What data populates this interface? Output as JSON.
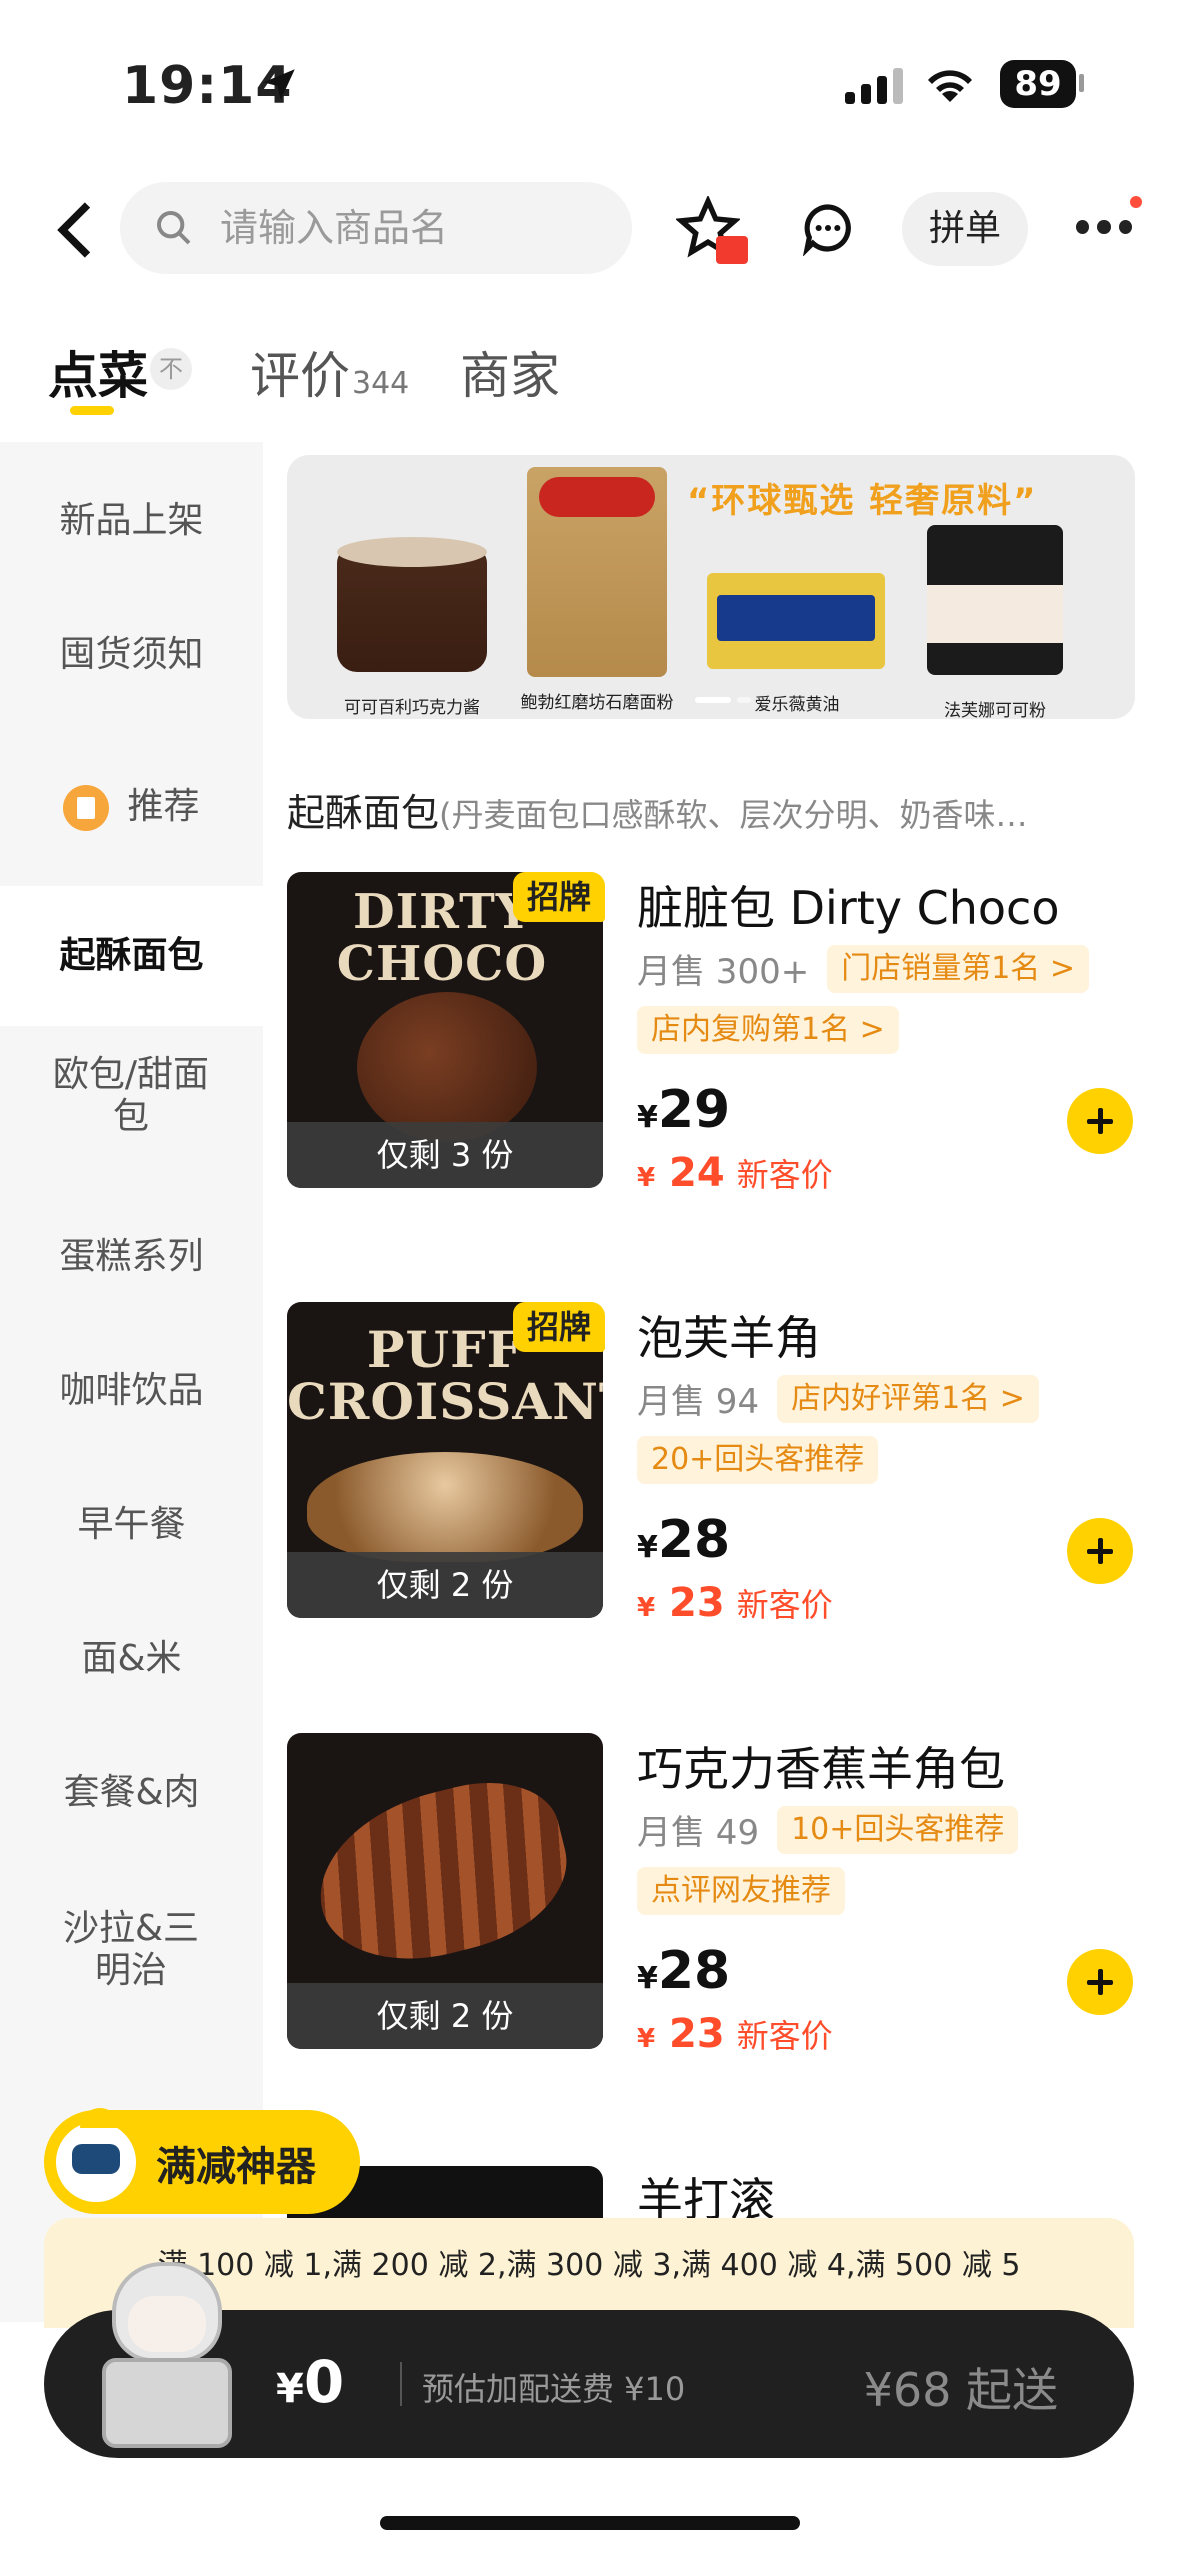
{
  "status_bar": {
    "time": "19:14",
    "battery": "89",
    "icons": [
      "location-arrow-icon",
      "signal-icon",
      "wifi-icon",
      "battery-icon"
    ]
  },
  "header": {
    "search_placeholder": "请输入商品名",
    "group_order_label": "拼单",
    "icons": [
      "back-icon",
      "search-icon",
      "favorite-star-icon",
      "chat-icon",
      "more-icon"
    ]
  },
  "tabs": [
    {
      "label": "点菜"
    },
    {
      "label": "评价",
      "count": "344"
    },
    {
      "label": "商家"
    }
  ],
  "tab_top_glyph": "不",
  "sidebar": {
    "items": [
      {
        "label": "新品上架"
      },
      {
        "label": "囤货须知"
      },
      {
        "label": "推荐"
      },
      {
        "label": "起酥面包"
      },
      {
        "label": "欧包/甜面包"
      },
      {
        "label": "蛋糕系列"
      },
      {
        "label": "咖啡饮品"
      },
      {
        "label": "早午餐"
      },
      {
        "label": "面&米"
      },
      {
        "label": "套餐&肉"
      },
      {
        "label": "沙拉&三明治"
      }
    ],
    "active_index": 3
  },
  "banner": {
    "slogan": "“环球甄选 轻奢原料”",
    "products": [
      {
        "caption": "可可百利巧克力酱"
      },
      {
        "caption": "鲍勃红磨坊石磨面粉"
      },
      {
        "caption": "爱乐薇黄油"
      },
      {
        "caption": "法芙娜可可粉"
      }
    ]
  },
  "section": {
    "title": "起酥面包",
    "description": "(丹麦面包口感酥软、层次分明、奶香味…"
  },
  "products": [
    {
      "image_text": "DIRTY CHOCO",
      "badge": "招牌",
      "remaining": "仅剩 3 份",
      "name": "脏脏包 Dirty Choco",
      "sales": "月售 300+",
      "tags": [
        "门店销量第1名 >",
        "店内复购第1名 >"
      ],
      "currency": "¥",
      "price": "29",
      "new_price": "24",
      "new_price_label": "新客价"
    },
    {
      "image_text": "PUFF CROISSANT",
      "badge": "招牌",
      "remaining": "仅剩 2 份",
      "name": "泡芙羊角",
      "sales": "月售 94",
      "tags": [
        "店内好评第1名 >",
        "20+回头客推荐"
      ],
      "currency": "¥",
      "price": "28",
      "new_price": "23",
      "new_price_label": "新客价"
    },
    {
      "image_text": "",
      "badge": "",
      "remaining": "仅剩 2 份",
      "name": "巧克力香蕉羊角包",
      "sales": "月售 49",
      "tags": [
        "10+回头客推荐",
        "点评网友推荐"
      ],
      "currency": "¥",
      "price": "28",
      "new_price": "23",
      "new_price_label": "新客价"
    },
    {
      "name": "羊打滚"
    }
  ],
  "promo": {
    "button_label": "满减神器",
    "discount_text": "满 100 减 1,满 200 减 2,满 300 减 3,满 400 减 4,满 500 减 5"
  },
  "cart": {
    "currency": "¥",
    "amount": "0",
    "delivery_fee": "预估加配送费 ¥10",
    "minimum": "¥68 起送"
  },
  "colors": {
    "accent": "#ffd100",
    "price_red": "#ff4d2b",
    "tag_orange": "#e58a12",
    "tag_bg": "#fff3dc"
  }
}
